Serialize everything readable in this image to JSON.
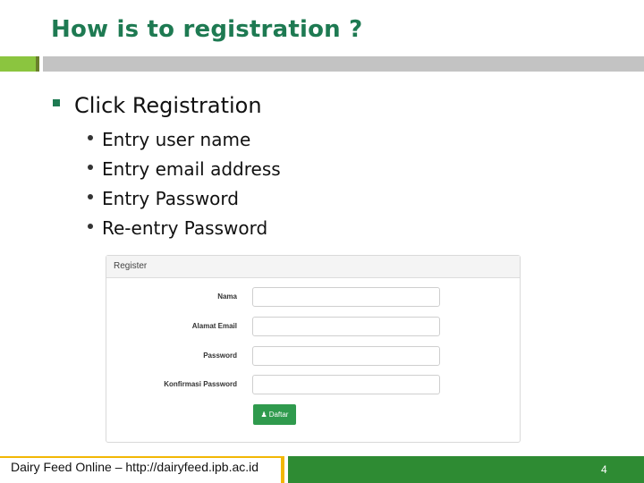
{
  "slide": {
    "title": "How is to registration ?",
    "main_bullet": "Click Registration",
    "sub_bullets": [
      "Entry user name",
      "Entry email address",
      "Entry Password",
      "Re-entry Password"
    ]
  },
  "form": {
    "header": "Register",
    "fields": [
      {
        "label": "Nama",
        "value": ""
      },
      {
        "label": "Alamat Email",
        "value": ""
      },
      {
        "label": "Password",
        "value": ""
      },
      {
        "label": "Konfirmasi Password",
        "value": ""
      }
    ],
    "submit_label": "Daftar",
    "submit_icon": "user-icon"
  },
  "footer": {
    "text": "Dairy Feed Online – http://dairyfeed.ipb.ac.id",
    "page_number": "4"
  },
  "colors": {
    "title": "#1e7a52",
    "accent_green": "#8bc53f",
    "footer_green": "#2e8b33",
    "footer_yellow": "#f2b705",
    "button": "#2f9a4d"
  }
}
